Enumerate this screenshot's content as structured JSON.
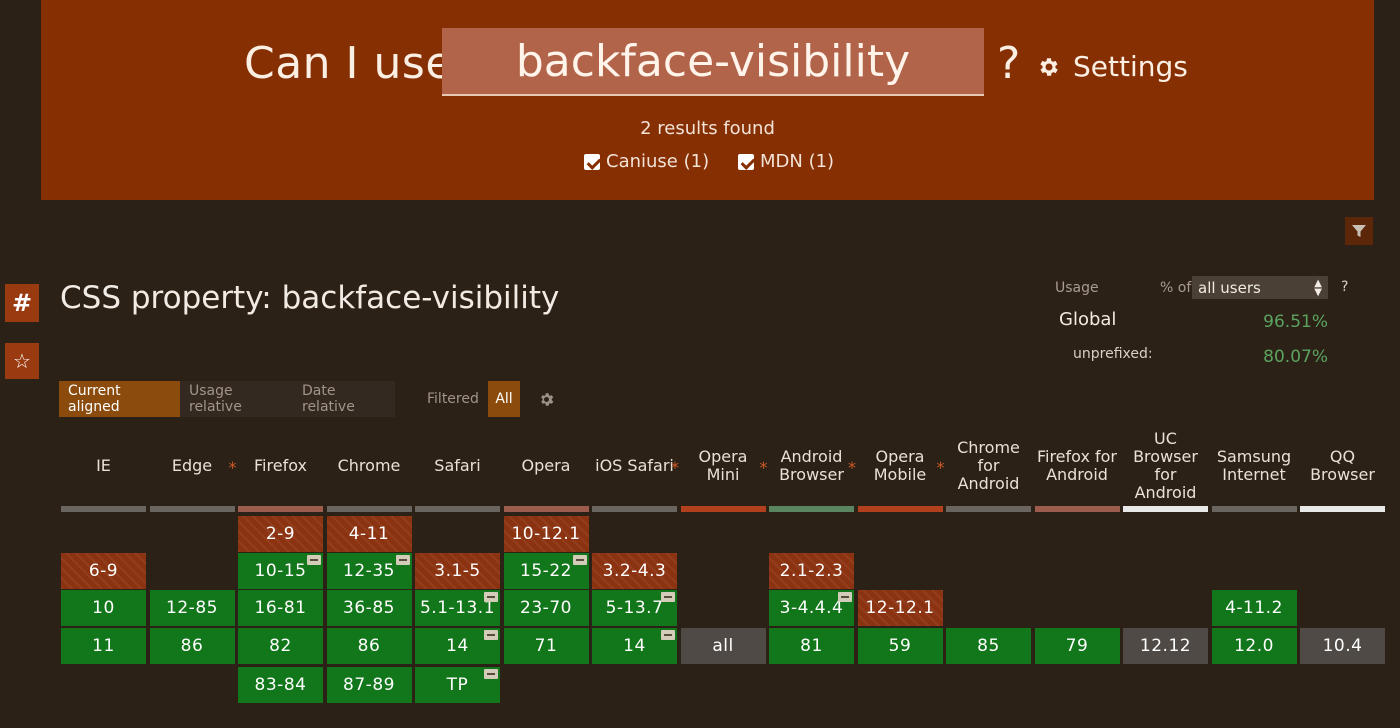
{
  "header": {
    "lead": "Can I use",
    "search_value": "backface-visibility",
    "question": "?",
    "settings_label": "Settings",
    "results_text": "2 results found",
    "sources": [
      "Caniuse (1)",
      "MDN (1)"
    ]
  },
  "feature": {
    "anchor_glyph": "#",
    "star_glyph": "☆",
    "title": "CSS property: backface-visibility"
  },
  "usage": {
    "label": "Usage",
    "pct_of": "% of",
    "users_option": "all users",
    "help": "?",
    "global_label": "Global",
    "global_value": "96.51%",
    "unprefixed_label": "unprefixed:",
    "unprefixed_value": "80.07%"
  },
  "view_tabs": {
    "current": "Current aligned",
    "usage": "Usage relative",
    "date": "Date relative",
    "filtered": "Filtered",
    "all": "All"
  },
  "browsers": [
    {
      "name": "IE",
      "asterisk": false,
      "bar": "#6b6560"
    },
    {
      "name": "Edge",
      "asterisk": true,
      "bar": "#6b6560"
    },
    {
      "name": "Firefox",
      "asterisk": false,
      "bar": "#9c5d4c"
    },
    {
      "name": "Chrome",
      "asterisk": false,
      "bar": "#6b6560"
    },
    {
      "name": "Safari",
      "asterisk": false,
      "bar": "#6b6560"
    },
    {
      "name": "Opera",
      "asterisk": false,
      "bar": "#9c5d4c"
    },
    {
      "name": "iOS Safari",
      "asterisk": true,
      "bar": "#6b6560"
    },
    {
      "name": "Opera Mini",
      "asterisk": true,
      "bar": "#b3401d"
    },
    {
      "name": "Android Browser",
      "asterisk": true,
      "bar": "#5a8560"
    },
    {
      "name": "Opera Mobile",
      "asterisk": true,
      "bar": "#b3401d"
    },
    {
      "name": "Chrome for Android",
      "asterisk": false,
      "bar": "#6b6560"
    },
    {
      "name": "Firefox for Android",
      "asterisk": false,
      "bar": "#9c5d4c"
    },
    {
      "name": "UC Browser for Android",
      "asterisk": false,
      "bar": "#e8e8e8"
    },
    {
      "name": "Samsung Internet",
      "asterisk": false,
      "bar": "#6b6560"
    },
    {
      "name": "QQ Browser",
      "asterisk": false,
      "bar": "#e8e8e8"
    }
  ],
  "support_cells": [
    {
      "col": 2,
      "row": 0,
      "text": "2-9",
      "status": "n",
      "note": false
    },
    {
      "col": 3,
      "row": 0,
      "text": "4-11",
      "status": "n",
      "note": false
    },
    {
      "col": 5,
      "row": 0,
      "text": "10-12.1",
      "status": "n",
      "note": false
    },
    {
      "col": 0,
      "row": 1,
      "text": "6-9",
      "status": "n",
      "note": false
    },
    {
      "col": 2,
      "row": 1,
      "text": "10-15",
      "status": "y",
      "note": true
    },
    {
      "col": 3,
      "row": 1,
      "text": "12-35",
      "status": "y",
      "note": true
    },
    {
      "col": 4,
      "row": 1,
      "text": "3.1-5",
      "status": "n",
      "note": false
    },
    {
      "col": 5,
      "row": 1,
      "text": "15-22",
      "status": "y",
      "note": true
    },
    {
      "col": 6,
      "row": 1,
      "text": "3.2-4.3",
      "status": "n",
      "note": false
    },
    {
      "col": 8,
      "row": 1,
      "text": "2.1-2.3",
      "status": "n",
      "note": false
    },
    {
      "col": 0,
      "row": 2,
      "text": "10",
      "status": "y",
      "note": false
    },
    {
      "col": 1,
      "row": 2,
      "text": "12-85",
      "status": "y",
      "note": false
    },
    {
      "col": 2,
      "row": 2,
      "text": "16-81",
      "status": "y",
      "note": false
    },
    {
      "col": 3,
      "row": 2,
      "text": "36-85",
      "status": "y",
      "note": false
    },
    {
      "col": 4,
      "row": 2,
      "text": "5.1-13.1",
      "status": "y",
      "note": true
    },
    {
      "col": 5,
      "row": 2,
      "text": "23-70",
      "status": "y",
      "note": false
    },
    {
      "col": 6,
      "row": 2,
      "text": "5-13.7",
      "status": "y",
      "note": true
    },
    {
      "col": 8,
      "row": 2,
      "text": "3-4.4.4",
      "status": "y",
      "note": true
    },
    {
      "col": 9,
      "row": 2,
      "text": "12-12.1",
      "status": "n",
      "note": false
    },
    {
      "col": 13,
      "row": 2,
      "text": "4-11.2",
      "status": "y",
      "note": false
    },
    {
      "col": 0,
      "row": 3,
      "text": "11",
      "status": "y",
      "note": false
    },
    {
      "col": 1,
      "row": 3,
      "text": "86",
      "status": "y",
      "note": false
    },
    {
      "col": 2,
      "row": 3,
      "text": "82",
      "status": "y",
      "note": false
    },
    {
      "col": 3,
      "row": 3,
      "text": "86",
      "status": "y",
      "note": false
    },
    {
      "col": 4,
      "row": 3,
      "text": "14",
      "status": "y",
      "note": true
    },
    {
      "col": 5,
      "row": 3,
      "text": "71",
      "status": "y",
      "note": false
    },
    {
      "col": 6,
      "row": 3,
      "text": "14",
      "status": "y",
      "note": true
    },
    {
      "col": 7,
      "row": 3,
      "text": "all",
      "status": "u",
      "note": false
    },
    {
      "col": 8,
      "row": 3,
      "text": "81",
      "status": "y",
      "note": false
    },
    {
      "col": 9,
      "row": 3,
      "text": "59",
      "status": "y",
      "note": false
    },
    {
      "col": 10,
      "row": 3,
      "text": "85",
      "status": "y",
      "note": false
    },
    {
      "col": 11,
      "row": 3,
      "text": "79",
      "status": "y",
      "note": false
    },
    {
      "col": 12,
      "row": 3,
      "text": "12.12",
      "status": "u",
      "note": false
    },
    {
      "col": 13,
      "row": 3,
      "text": "12.0",
      "status": "y",
      "note": false
    },
    {
      "col": 14,
      "row": 3,
      "text": "10.4",
      "status": "u",
      "note": false
    },
    {
      "col": 2,
      "row": 4,
      "text": "83-84",
      "status": "y",
      "note": false
    },
    {
      "col": 3,
      "row": 4,
      "text": "87-89",
      "status": "y",
      "note": false
    },
    {
      "col": 4,
      "row": 4,
      "text": "TP",
      "status": "y",
      "note": true
    }
  ]
}
